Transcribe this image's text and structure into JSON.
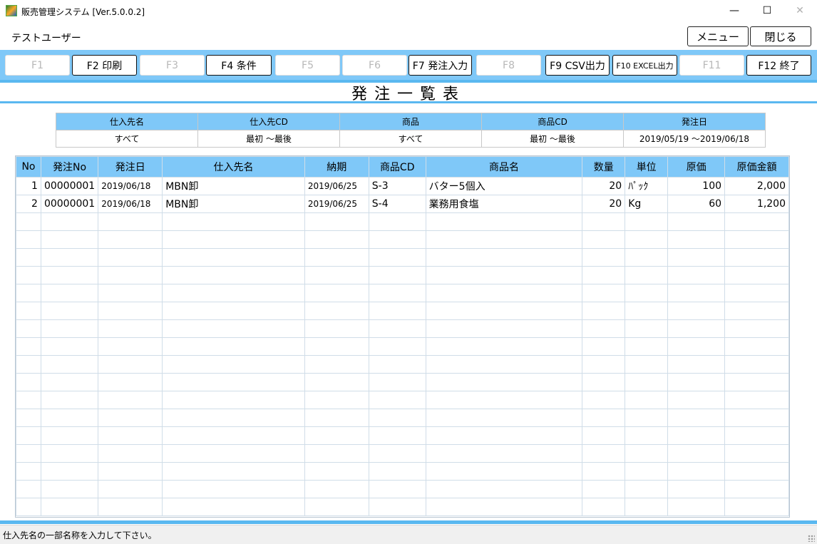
{
  "window": {
    "title": "販売管理システム [Ver.5.0.0.2]",
    "minimize_glyph": "—",
    "maximize_glyph": "☐",
    "close_glyph": "✕"
  },
  "header": {
    "user": "テストユーザー",
    "menu_label": "メニュー",
    "close_label": "閉じる"
  },
  "fkeys": [
    {
      "label": "F1",
      "enabled": false
    },
    {
      "label": "F2 印刷",
      "enabled": true
    },
    {
      "label": "F3",
      "enabled": false
    },
    {
      "label": "F4 条件",
      "enabled": true
    },
    {
      "label": "F5",
      "enabled": false
    },
    {
      "label": "F6",
      "enabled": false
    },
    {
      "label": "F7 発注入力",
      "enabled": true
    },
    {
      "label": "F8",
      "enabled": false
    },
    {
      "label": "F9 CSV出力",
      "enabled": true
    },
    {
      "label": "F10 EXCEL出力",
      "enabled": true
    },
    {
      "label": "F11",
      "enabled": false
    },
    {
      "label": "F12 終了",
      "enabled": true
    }
  ],
  "page_title": "発注一覧表",
  "conditions": {
    "headers": [
      "仕入先名",
      "仕入先CD",
      "商品",
      "商品CD",
      "発注日"
    ],
    "values": [
      "すべて",
      "最初 ～最後",
      "すべて",
      "最初 ～最後",
      "2019/05/19 ～2019/06/18"
    ]
  },
  "grid": {
    "columns": [
      "No",
      "発注No",
      "発注日",
      "仕入先名",
      "納期",
      "商品CD",
      "商品名",
      "数量",
      "単位",
      "原価",
      "原価金額"
    ],
    "rows": [
      [
        "1",
        "00000001",
        "2019/06/18",
        "MBN卸",
        "2019/06/25",
        "S-3",
        "バター5個入",
        "20",
        "ﾊﾟｯｸ",
        "100",
        "2,000"
      ],
      [
        "2",
        "00000001",
        "2019/06/18",
        "MBN卸",
        "2019/06/25",
        "S-4",
        "業務用食塩",
        "20",
        "Kg",
        "60",
        "1,200"
      ]
    ]
  },
  "status": "仕入先名の一部名称を入力して下さい。"
}
